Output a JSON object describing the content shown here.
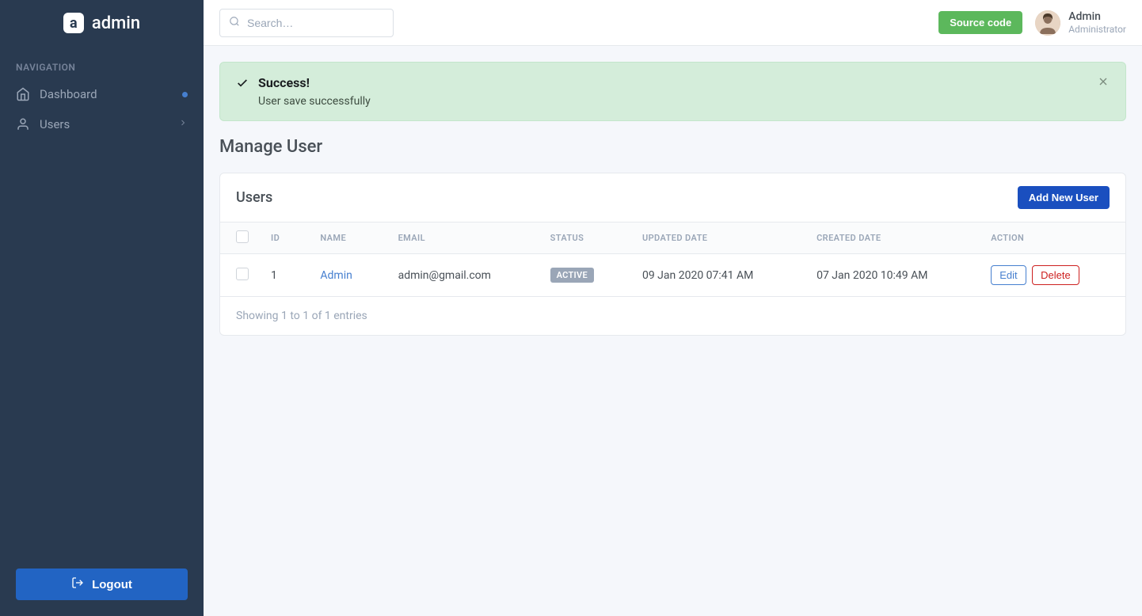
{
  "brand": {
    "name": "admin",
    "logo_letter": "a"
  },
  "nav": {
    "header": "NAVIGATION",
    "items": [
      {
        "label": "Dashboard",
        "icon": "home",
        "indicator": "dot"
      },
      {
        "label": "Users",
        "icon": "user",
        "indicator": "chevron"
      }
    ]
  },
  "logout_label": "Logout",
  "search": {
    "placeholder": "Search…"
  },
  "topbar": {
    "source_code_label": "Source code",
    "user": {
      "name": "Admin",
      "role": "Administrator"
    }
  },
  "alert": {
    "title": "Success!",
    "message": "User save successfully"
  },
  "page_title": "Manage User",
  "card": {
    "title": "Users",
    "add_button": "Add New User",
    "columns": {
      "id": "ID",
      "name": "NAME",
      "email": "EMAIL",
      "status": "STATUS",
      "updated": "UPDATED DATE",
      "created": "CREATED DATE",
      "action": "ACTION"
    },
    "rows": [
      {
        "id": "1",
        "name": "Admin",
        "email": "admin@gmail.com",
        "status": "ACTIVE",
        "updated": "09 Jan 2020 07:41 AM",
        "created": "07 Jan 2020 10:49 AM"
      }
    ],
    "actions": {
      "edit": "Edit",
      "delete": "Delete"
    },
    "footer": "Showing 1 to 1 of 1 entries"
  }
}
